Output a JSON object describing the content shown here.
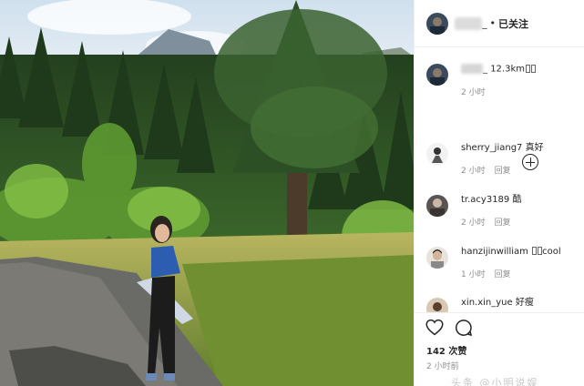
{
  "post": {
    "header": {
      "username_suffix": "_",
      "separator": "•",
      "follow_state": "已关注"
    },
    "caption": {
      "username_suffix": "_",
      "location_text": "12.3km",
      "time": "2 小时"
    },
    "comments": [
      {
        "username": "sherry_jiang7",
        "text": "真好",
        "time": "2 小时",
        "reply": "回复"
      },
      {
        "username": "tr.acy3189",
        "text": "酷",
        "time": "2 小时",
        "reply": "回复"
      },
      {
        "username": "hanzijinwilliam",
        "text": "cool",
        "time": "1 小时",
        "reply": "回复"
      },
      {
        "username": "xin.xin_yue",
        "text": "好瘦"
      }
    ],
    "likes": "142 次赞",
    "time_ago": "2 小时前",
    "watermark": "头条 @小明说娱"
  },
  "icons": [
    "heart-icon",
    "comment-icon",
    "plus-circle-icon"
  ],
  "colors": {
    "text": "#262626",
    "muted": "#8e8e8e",
    "divider": "#efefef"
  }
}
